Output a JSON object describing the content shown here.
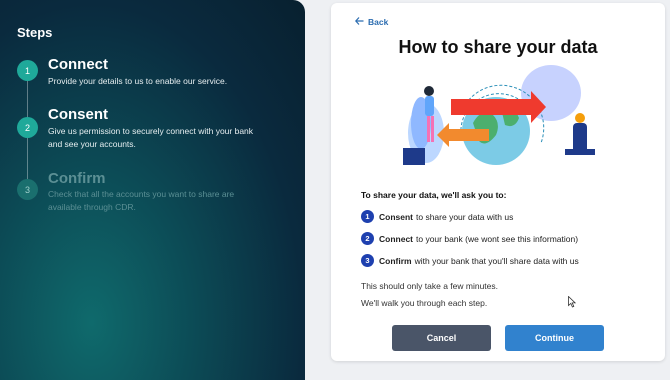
{
  "sidebar": {
    "heading": "Steps",
    "steps": [
      {
        "number": "1",
        "title": "Connect",
        "description": "Provide your details to us to enable our service."
      },
      {
        "number": "2",
        "title": "Consent",
        "description": "Give us permission to securely connect with your bank and see your accounts."
      },
      {
        "number": "3",
        "title": "Confirm",
        "description": "Check that all the accounts you want to share are available through CDR."
      }
    ]
  },
  "card": {
    "back_label": "Back",
    "title": "How to share your data",
    "intro": "To share your data, we'll ask you to:",
    "items": [
      {
        "number": "1",
        "bold": "Consent",
        "rest": "to share your data with us"
      },
      {
        "number": "2",
        "bold": "Connect",
        "rest": "to your bank (we wont see this information)"
      },
      {
        "number": "3",
        "bold": "Confirm",
        "rest": "with your bank that you'll share data with us"
      }
    ],
    "note_1": "This should only take a few minutes.",
    "note_2": "We'll walk you through each step.",
    "cancel_label": "Cancel",
    "continue_label": "Continue"
  },
  "colors": {
    "accent": "#3182ce",
    "step_active": "#1fa99a",
    "number_badge": "#1e40af"
  },
  "icons": [
    "back-arrow-icon",
    "data-sharing-illustration",
    "mouse-cursor-icon"
  ]
}
